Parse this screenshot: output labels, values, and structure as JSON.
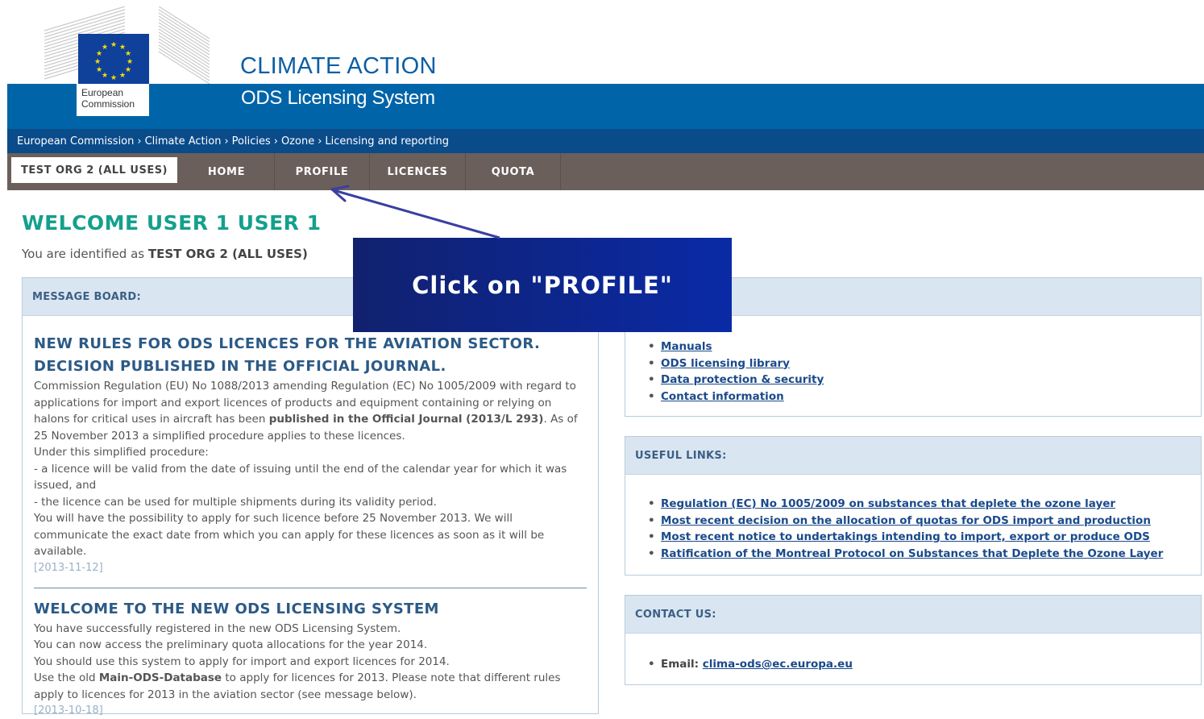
{
  "header": {
    "logo_line1": "European",
    "logo_line2": "Commission",
    "site_title": "CLIMATE ACTION",
    "site_subtitle": "ODS Licensing System"
  },
  "breadcrumb": [
    "European Commission",
    "Climate Action",
    "Policies",
    "Ozone",
    "Licensing and reporting"
  ],
  "nav": {
    "org": "TEST ORG 2 (ALL USES)",
    "home": "HOME",
    "profile": "PROFILE",
    "licences": "LICENCES",
    "quota": "QUOTA"
  },
  "welcome": {
    "title": "WELCOME USER 1 USER 1",
    "identified_prefix": "You are identified as",
    "identified_org": "TEST ORG 2 (ALL USES)"
  },
  "message_board": {
    "heading": "MESSAGE BOARD:",
    "news1": {
      "title_line1": "NEW RULES FOR ODS LICENCES FOR THE AVIATION SECTOR.",
      "title_line2": "DECISION PUBLISHED IN THE OFFICIAL JOURNAL.",
      "p1_a": "Commission Regulation (EU) No 1088/2013 amending Regulation (EC) No 1005/2009 with regard to applications for import and export licences of products and equipment containing or relying on halons for critical uses in aircraft has been",
      "p1_bold": "published in the Official Journal (2013/L 293)",
      "p1_b": ". As of 25 November 2013 a simplified procedure applies to these licences.",
      "p2": "Under this simplified procedure:",
      "p3": "- a licence will be valid from the date of issuing until the end of the calendar year for which it was issued, and",
      "p4": "- the licence can be used for multiple shipments during its validity period.",
      "p5": "You will have the possibility to apply for such licence before 25 November 2013. We will communicate the exact date from which you can apply for these licences as soon as it will be available.",
      "date": "[2013-11-12]"
    },
    "news2": {
      "title": "WELCOME TO THE NEW ODS LICENSING SYSTEM",
      "p1": "You have successfully registered in the new ODS Licensing System.",
      "p2": "You can now access the preliminary quota allocations for the year 2014.",
      "p3": "You should use this system to apply for import and export licences for 2014.",
      "p4_a": "Use the old",
      "p4_bold": "Main-ODS-Database",
      "p4_b": "to apply for licences for 2013. Please note that different rules apply to licences for 2013 in the aviation sector (see message below).",
      "date": "[2013-10-18]"
    }
  },
  "help_links": [
    "Manuals",
    "ODS licensing library",
    "Data protection & security",
    "Contact information"
  ],
  "useful_links": {
    "heading": "USEFUL LINKS:",
    "items": [
      "Regulation (EC) No 1005/2009 on substances that deplete the ozone layer",
      "Most recent decision on the allocation of quotas for ODS import and production",
      "Most recent notice to undertakings intending to import, export or produce ODS",
      "Ratification of the Montreal Protocol on Substances that Deplete the Ozone Layer"
    ]
  },
  "contact": {
    "heading": "CONTACT US:",
    "email_label": "Email:",
    "email": "clima-ods@ec.europa.eu"
  },
  "callout": {
    "text": "Click on \"PROFILE\""
  },
  "colors": {
    "header_blue": "#0064a8",
    "breadcrumb_blue": "#0a4b8a",
    "nav_brown": "#6b5f5b",
    "welcome_green": "#14a08c",
    "callout_blue": "#0a2aa6"
  }
}
